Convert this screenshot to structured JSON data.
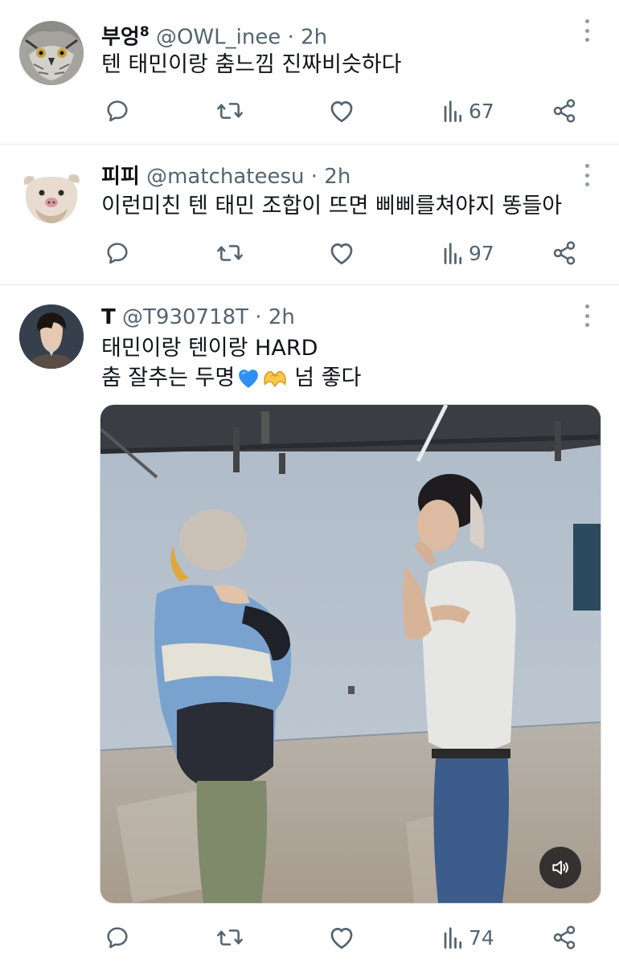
{
  "tweets": [
    {
      "name": "부엉",
      "name_sup": "8",
      "handle": "@OWL_inee",
      "time": "· 2h",
      "lines": [
        "텐 태민이랑 춤느낌 진짜비슷하다"
      ],
      "avatar_icon": "owl-avatar",
      "views": "67"
    },
    {
      "name": "피피",
      "handle": "@matchateesu",
      "time": "· 2h",
      "lines": [
        "이런미친 텐 태민 조합이 뜨면 삐삐를쳐야지 똥들아"
      ],
      "avatar_icon": "cat-avatar",
      "views": "97"
    },
    {
      "name": "T",
      "handle": "@T930718T",
      "time": "· 2h",
      "lines": [
        "태민이랑 텐이랑 HARD",
        "춤 잘추는 두명",
        "넘 좋다"
      ],
      "emojis": [
        "blue-heart-icon",
        "heart-hands-icon"
      ],
      "avatar_icon": "person-avatar",
      "views": "74",
      "media": {
        "type": "video",
        "description_icon": "dance-practice-video",
        "muted": true
      }
    }
  ],
  "colors": {
    "text": "#0f1419",
    "secondary": "#536471",
    "divider": "#e6e9ec",
    "blue_heart": "#2f8ff0"
  }
}
